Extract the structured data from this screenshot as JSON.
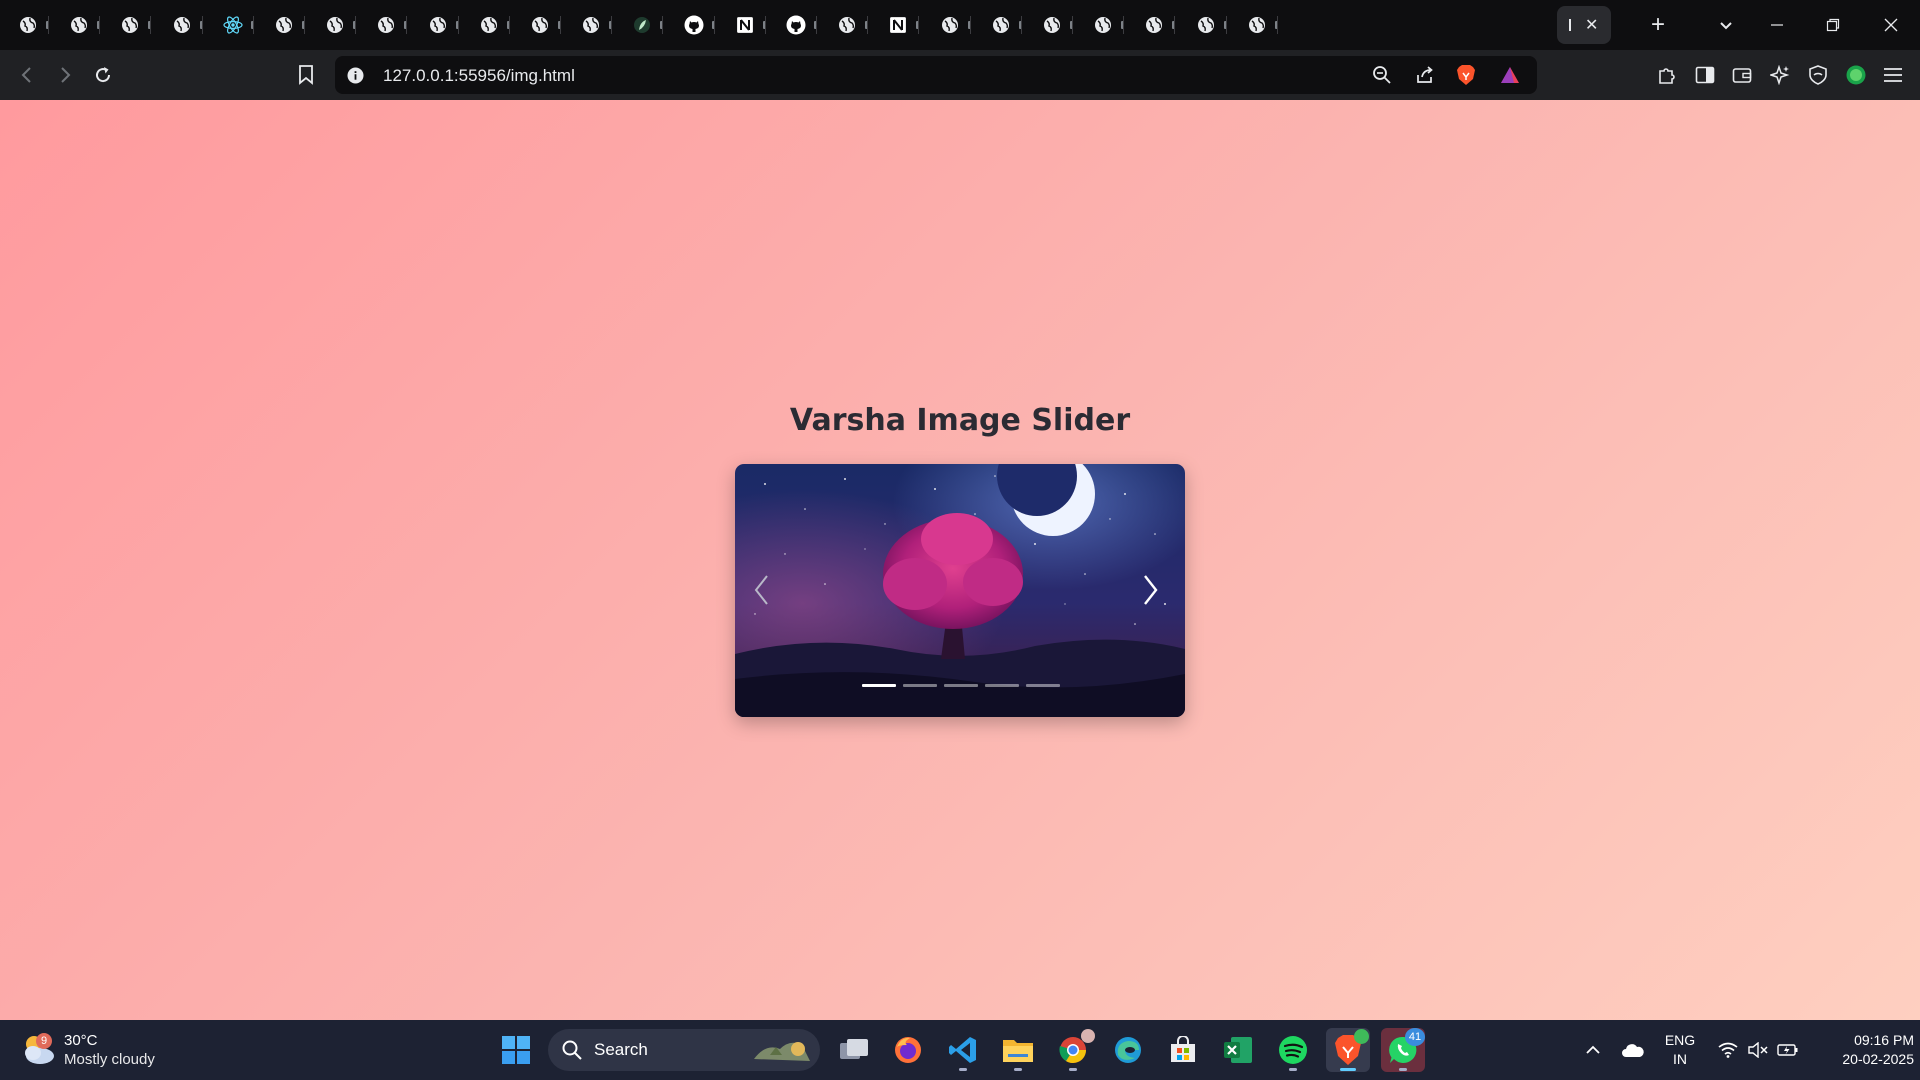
{
  "browser": {
    "address_bar_url": "127.0.0.1:55956/img.html",
    "tabs": [
      {
        "icon": "globe-icon"
      },
      {
        "icon": "globe-icon"
      },
      {
        "icon": "globe-icon"
      },
      {
        "icon": "globe-icon"
      },
      {
        "icon": "react-icon"
      },
      {
        "icon": "globe-icon"
      },
      {
        "icon": "globe-icon"
      },
      {
        "icon": "globe-icon"
      },
      {
        "icon": "globe-icon"
      },
      {
        "icon": "globe-icon"
      },
      {
        "icon": "globe-icon"
      },
      {
        "icon": "globe-icon"
      },
      {
        "icon": "leaf-icon"
      },
      {
        "icon": "github-icon"
      },
      {
        "icon": "notion-icon"
      },
      {
        "icon": "github-icon"
      },
      {
        "icon": "globe-icon"
      },
      {
        "icon": "notion-icon"
      },
      {
        "icon": "globe-icon"
      },
      {
        "icon": "globe-icon"
      },
      {
        "icon": "globe-icon"
      },
      {
        "icon": "globe-icon"
      },
      {
        "icon": "globe-icon"
      },
      {
        "icon": "globe-icon"
      },
      {
        "icon": "globe-icon"
      }
    ],
    "active_tab_close_glyph": "✕",
    "new_tab_glyph": "+"
  },
  "page": {
    "title": "Varsha Image Slider",
    "slider": {
      "prev_glyph": "‹",
      "next_glyph": "›",
      "slide_count": 5,
      "active_slide": 1
    },
    "background_gradient": [
      "#ff9a9e",
      "#fecfc0"
    ]
  },
  "taskbar": {
    "weather": {
      "temperature": "30°C",
      "condition": "Mostly cloudy",
      "badge": "9"
    },
    "search_label": "Search",
    "apps": [
      "start",
      "search",
      "task-view",
      "firefox",
      "vscode",
      "file-explorer",
      "chrome",
      "edge",
      "microsoft-store",
      "excel",
      "spotify",
      "brave",
      "whatsapp"
    ],
    "whatsapp_badge": "41",
    "language": {
      "line1": "ENG",
      "line2": "IN"
    },
    "clock": {
      "time": "09:16 PM",
      "date": "20-02-2025"
    }
  },
  "colors": {
    "tabstrip": "#0e0e10",
    "toolbar": "#202124",
    "taskbar": "#1d2233",
    "brave_orange": "#fb542b",
    "title_text": "#2b2b33"
  }
}
